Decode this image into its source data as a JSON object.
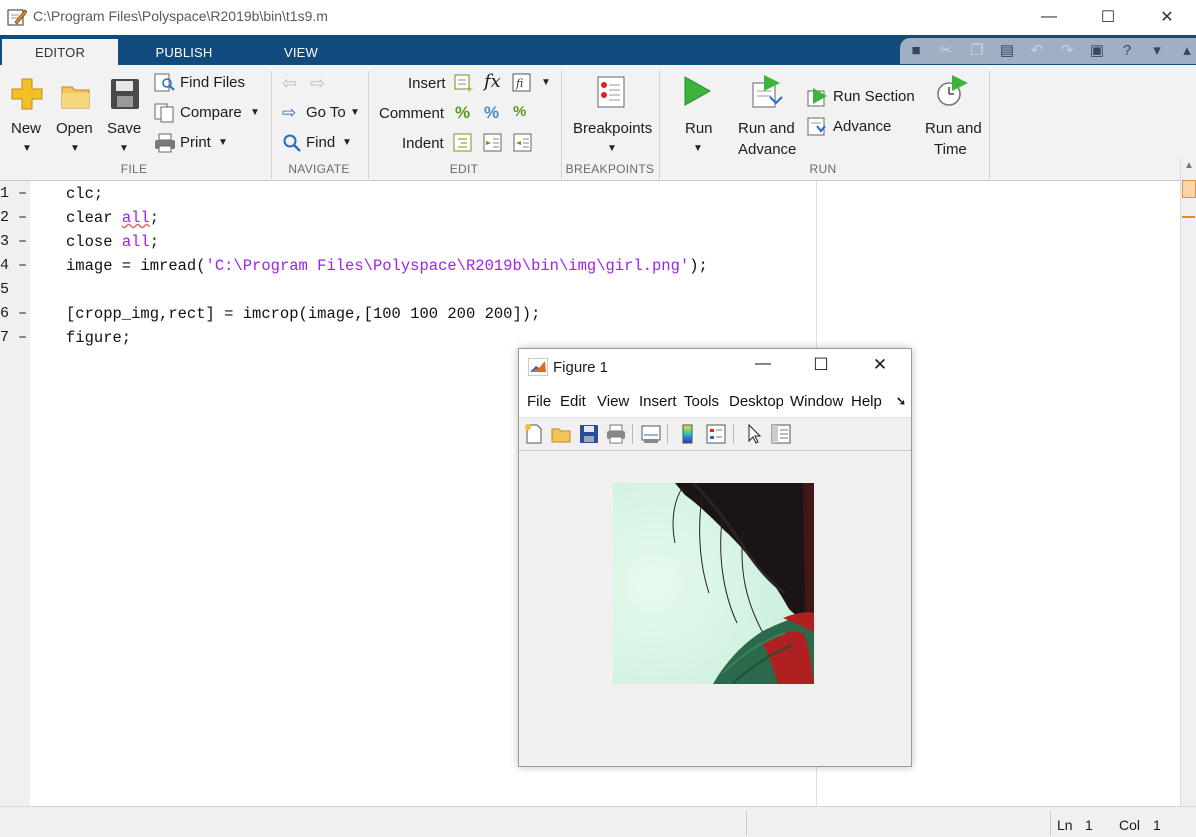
{
  "window": {
    "title": "C:\\Program Files\\Polyspace\\R2019b\\bin\\t1s9.m"
  },
  "tabs": [
    "EDITOR",
    "PUBLISH",
    "VIEW"
  ],
  "ribbon": {
    "file": {
      "new": "New",
      "open": "Open",
      "save": "Save",
      "find_files": "Find Files",
      "compare": "Compare",
      "print": "Print",
      "group": "FILE"
    },
    "navigate": {
      "go_to": "Go To",
      "find": "Find",
      "group": "NAVIGATE"
    },
    "edit": {
      "insert": "Insert",
      "comment": "Comment",
      "indent": "Indent",
      "group": "EDIT"
    },
    "breakpoints": {
      "label": "Breakpoints",
      "group": "BREAKPOINTS"
    },
    "run": {
      "run": "Run",
      "run_advance_1": "Run and",
      "run_advance_2": "Advance",
      "run_section": "Run Section",
      "advance": "Advance",
      "run_time_1": "Run and",
      "run_time_2": "Time",
      "group": "RUN"
    }
  },
  "editor": {
    "lines": [
      {
        "n": "1",
        "marker": "–"
      },
      {
        "n": "2",
        "marker": "–"
      },
      {
        "n": "3",
        "marker": "–"
      },
      {
        "n": "4",
        "marker": "–"
      },
      {
        "n": "5",
        "marker": ""
      },
      {
        "n": "6",
        "marker": "–"
      },
      {
        "n": "7",
        "marker": "–"
      }
    ],
    "code": {
      "l1": "clc;",
      "l2a": "clear ",
      "l2b": "all",
      "l2c": ";",
      "l3a": "close ",
      "l3b": "all",
      "l3c": ";",
      "l4a": "image = imread(",
      "l4b": "'C:\\Program Files\\Polyspace\\R2019b\\bin\\img\\girl.png'",
      "l4c": ");",
      "l6": "[cropp_img,rect] = imcrop(image,[100 100 200 200]);",
      "l7": "figure;"
    }
  },
  "status": {
    "ln_label": "Ln",
    "ln_value": "1",
    "col_label": "Col",
    "col_value": "1"
  },
  "figure": {
    "title": "Figure 1",
    "menu": [
      "File",
      "Edit",
      "View",
      "Insert",
      "Tools",
      "Desktop",
      "Window",
      "Help"
    ]
  },
  "colors": {
    "tabstrip": "#114a7c",
    "keyword": "#a020f0",
    "run_green": "#3cb43c"
  }
}
